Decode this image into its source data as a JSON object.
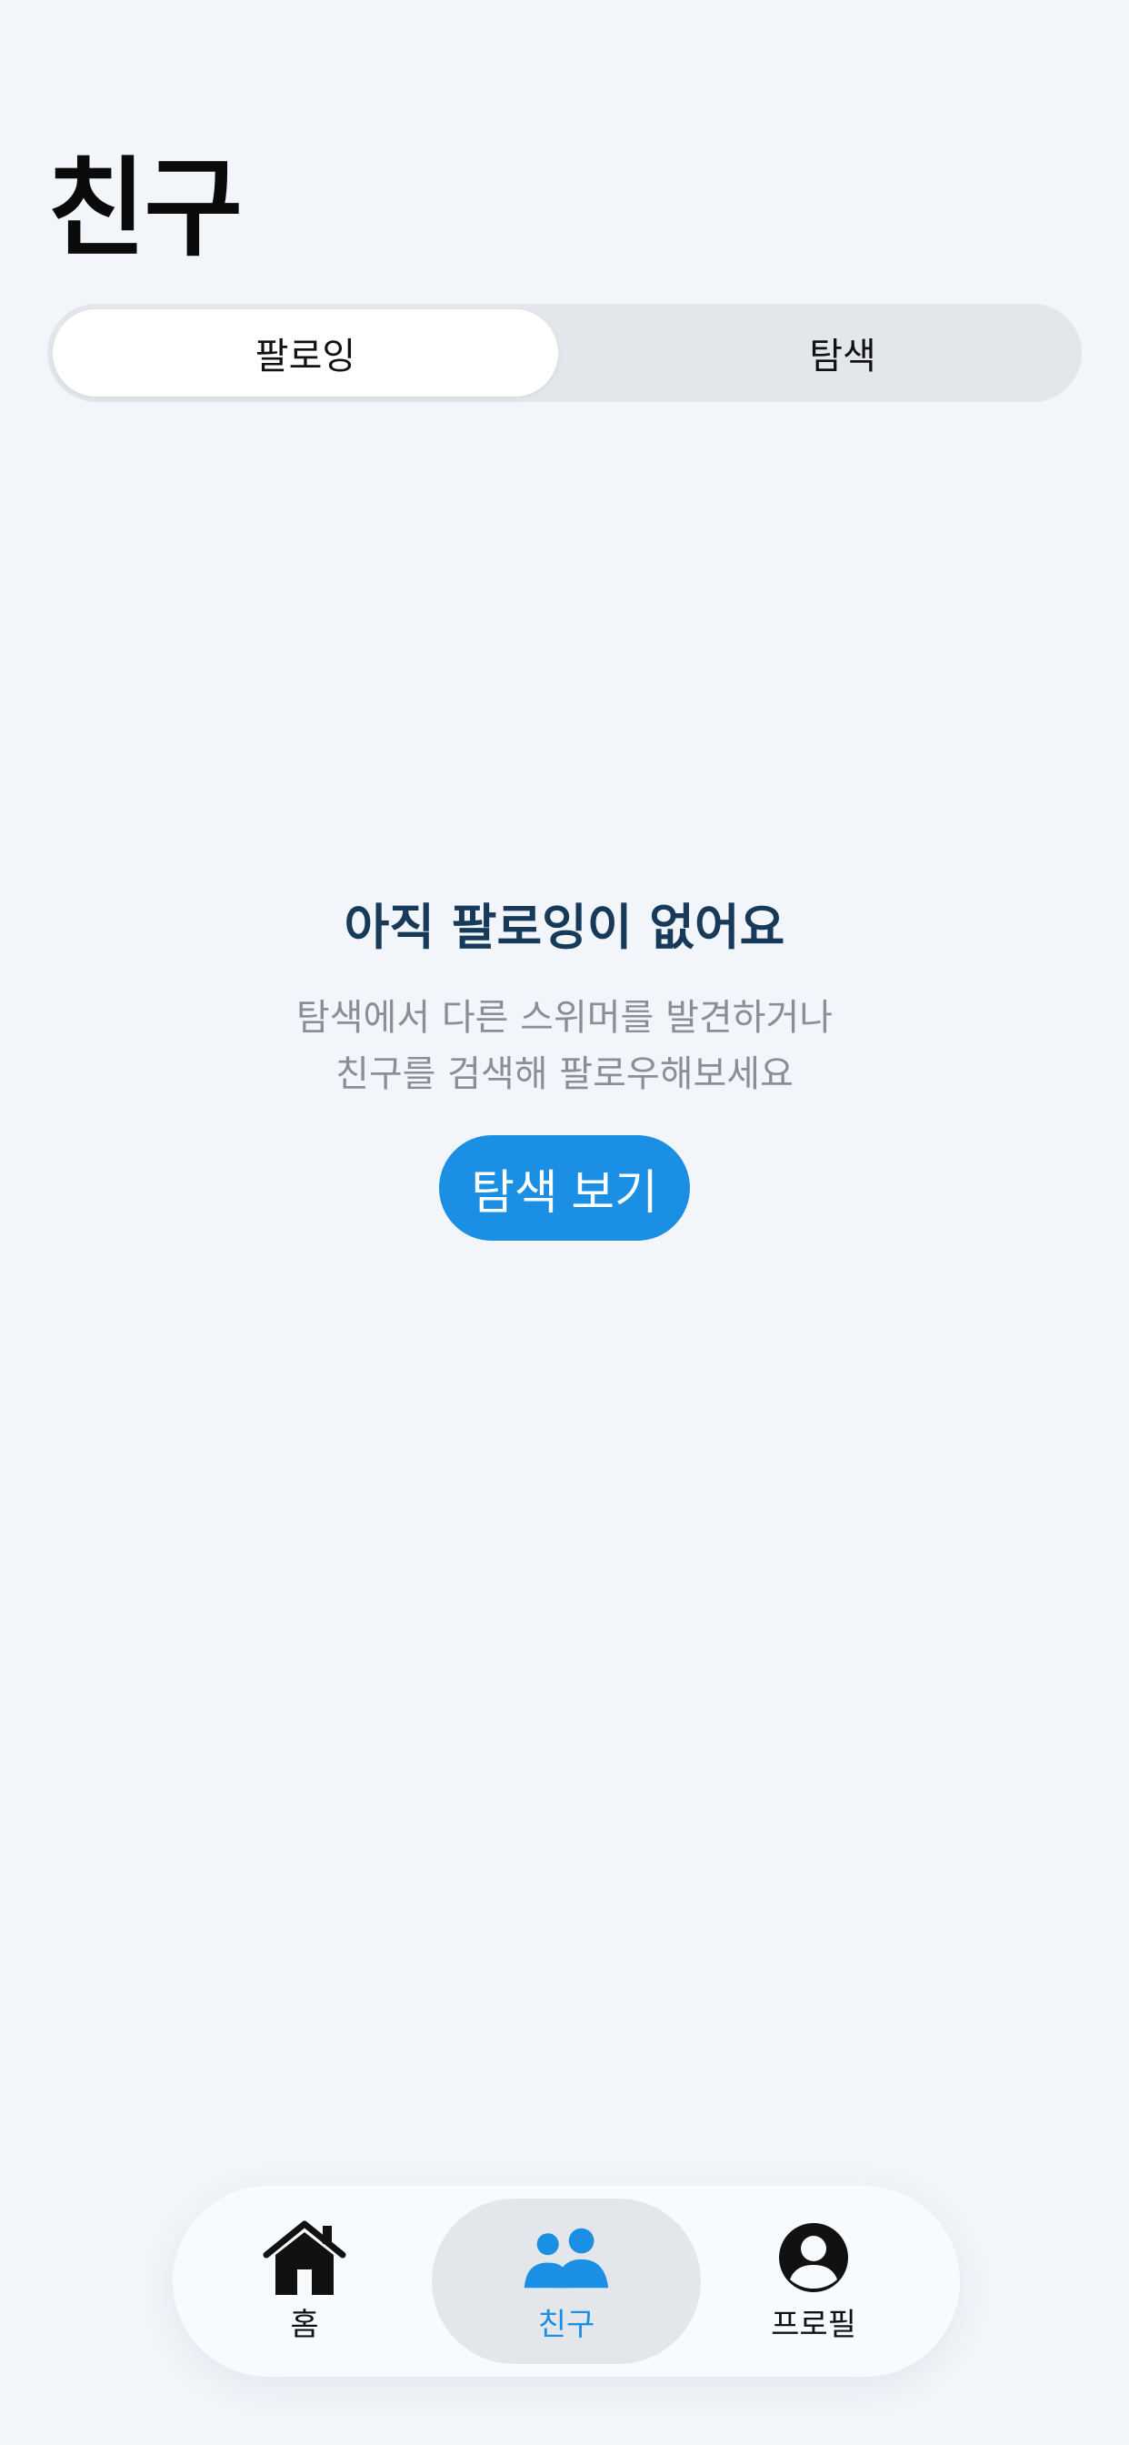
{
  "header": {
    "title": "친구"
  },
  "segments": {
    "following": "팔로잉",
    "explore": "탐색"
  },
  "empty_state": {
    "title": "아직 팔로잉이 없어요",
    "desc_line1": "탐색에서 다른 스위머를 발견하거나",
    "desc_line2": "친구를 검색해 팔로우해보세요",
    "button_label": "탐색 보기"
  },
  "tabbar": {
    "home": {
      "label": "홈",
      "icon": "home-icon"
    },
    "friends": {
      "label": "친구",
      "icon": "people-icon"
    },
    "profile": {
      "label": "프로필",
      "icon": "person-circle-icon"
    }
  },
  "colors": {
    "background": "#f2f6fa",
    "accent": "#1a8fe3",
    "title_dark": "#173a5a",
    "muted_text": "#8a8f96",
    "segment_bg": "#e3e7ec"
  }
}
